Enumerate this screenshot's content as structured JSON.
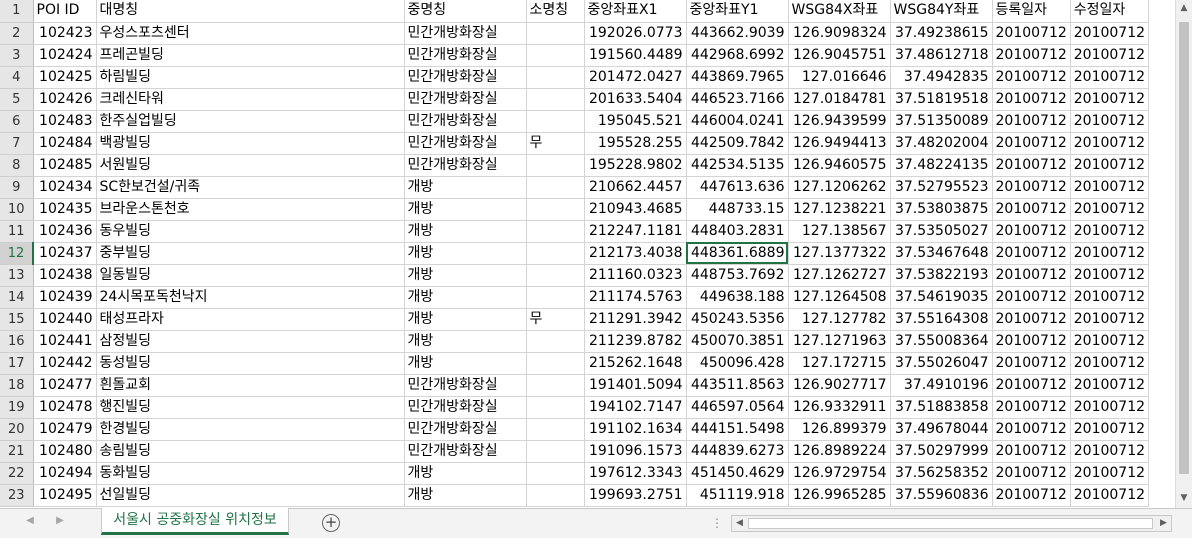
{
  "columns": [
    "POI ID",
    "대명칭",
    "중명칭",
    "소명칭",
    "중앙좌표X1",
    "중앙좌표Y1",
    "WSG84X좌표",
    "WSG84Y좌표",
    "등록일자",
    "수정일자"
  ],
  "rows": [
    [
      "102423",
      "우성스포츠센터",
      "민간개방화장실",
      "",
      "192026.0773",
      "443662.9039",
      "126.9098324",
      "37.49238615",
      "20100712",
      "20100712"
    ],
    [
      "102424",
      "프레곤빌딩",
      "민간개방화장실",
      "",
      "191560.4489",
      "442968.6992",
      "126.9045751",
      "37.48612718",
      "20100712",
      "20100712"
    ],
    [
      "102425",
      "하림빌딩",
      "민간개방화장실",
      "",
      "201472.0427",
      "443869.7965",
      "127.016646",
      "37.4942835",
      "20100712",
      "20100712"
    ],
    [
      "102426",
      "크레신타워",
      "민간개방화장실",
      "",
      "201633.5404",
      "446523.7166",
      "127.0184781",
      "37.51819518",
      "20100712",
      "20100712"
    ],
    [
      "102483",
      "한주실업빌딩",
      "민간개방화장실",
      "",
      "195045.521",
      "446004.0241",
      "126.9439599",
      "37.51350089",
      "20100712",
      "20100712"
    ],
    [
      "102484",
      "백광빌딩",
      "민간개방화장실",
      "무",
      "195528.255",
      "442509.7842",
      "126.9494413",
      "37.48202004",
      "20100712",
      "20100712"
    ],
    [
      "102485",
      "서원빌딩",
      "민간개방화장실",
      "",
      "195228.9802",
      "442534.5135",
      "126.9460575",
      "37.48224135",
      "20100712",
      "20100712"
    ],
    [
      "102434",
      "SC한보건설/귀족",
      "개방",
      "",
      "210662.4457",
      "447613.636",
      "127.1206262",
      "37.52795523",
      "20100712",
      "20100712"
    ],
    [
      "102435",
      "브라운스톤천호",
      "개방",
      "",
      "210943.4685",
      "448733.15",
      "127.1238221",
      "37.53803875",
      "20100712",
      "20100712"
    ],
    [
      "102436",
      "동우빌딩",
      "개방",
      "",
      "212247.1181",
      "448403.2831",
      "127.138567",
      "37.53505027",
      "20100712",
      "20100712"
    ],
    [
      "102437",
      "중부빌딩",
      "개방",
      "",
      "212173.4038",
      "448361.6889",
      "127.1377322",
      "37.53467648",
      "20100712",
      "20100712"
    ],
    [
      "102438",
      "일동빌딩",
      "개방",
      "",
      "211160.0323",
      "448753.7692",
      "127.1262727",
      "37.53822193",
      "20100712",
      "20100712"
    ],
    [
      "102439",
      "24시목포독천낙지",
      "개방",
      "",
      "211174.5763",
      "449638.188",
      "127.1264508",
      "37.54619035",
      "20100712",
      "20100712"
    ],
    [
      "102440",
      "태성프라자",
      "개방",
      "무",
      "211291.3942",
      "450243.5356",
      "127.127782",
      "37.55164308",
      "20100712",
      "20100712"
    ],
    [
      "102441",
      "삼정빌딩",
      "개방",
      "",
      "211239.8782",
      "450070.3851",
      "127.1271963",
      "37.55008364",
      "20100712",
      "20100712"
    ],
    [
      "102442",
      "동성빌딩",
      "개방",
      "",
      "215262.1648",
      "450096.428",
      "127.172715",
      "37.55026047",
      "20100712",
      "20100712"
    ],
    [
      "102477",
      "흰돌교회",
      "민간개방화장실",
      "",
      "191401.5094",
      "443511.8563",
      "126.9027717",
      "37.4910196",
      "20100712",
      "20100712"
    ],
    [
      "102478",
      "행진빌딩",
      "민간개방화장실",
      "",
      "194102.7147",
      "446597.0564",
      "126.9332911",
      "37.51883858",
      "20100712",
      "20100712"
    ],
    [
      "102479",
      "한경빌딩",
      "민간개방화장실",
      "",
      "191102.1634",
      "444151.5498",
      "126.899379",
      "37.49678044",
      "20100712",
      "20100712"
    ],
    [
      "102480",
      "송림빌딩",
      "민간개방화장실",
      "",
      "191096.1573",
      "444839.6273",
      "126.8989224",
      "37.50297999",
      "20100712",
      "20100712"
    ],
    [
      "102494",
      "동화빌딩",
      "개방",
      "",
      "197612.3343",
      "451450.4629",
      "126.9729754",
      "37.56258352",
      "20100712",
      "20100712"
    ],
    [
      "102495",
      "선일빌딩",
      "개방",
      "",
      "199693.2751",
      "451119.918",
      "126.9965285",
      "37.55960836",
      "20100712",
      "20100712"
    ]
  ],
  "row_numbers": [
    "1",
    "2",
    "3",
    "4",
    "5",
    "6",
    "7",
    "8",
    "9",
    "10",
    "11",
    "12",
    "13",
    "14",
    "15",
    "16",
    "17",
    "18",
    "19",
    "20",
    "21",
    "22",
    "23"
  ],
  "active_row_number": "12",
  "selected_cell": {
    "row_number": "12",
    "column": "중앙좌표Y1"
  },
  "sheet_tab": {
    "label": "서울시 공중화장실 위치정보"
  },
  "icons": {
    "add_sheet": "plus-circle-icon",
    "scroll_up": "triangle-up-icon",
    "scroll_down": "triangle-down-icon",
    "scroll_left": "triangle-left-icon",
    "scroll_right": "triangle-right-icon",
    "tab_nav_prev": "chevron-left-icon",
    "tab_nav_next": "chevron-right-icon",
    "split": "more-vertical-icon"
  },
  "colors": {
    "accent": "#217346",
    "grid": "#d4d4d4",
    "header_bg": "#e6e6e6"
  }
}
